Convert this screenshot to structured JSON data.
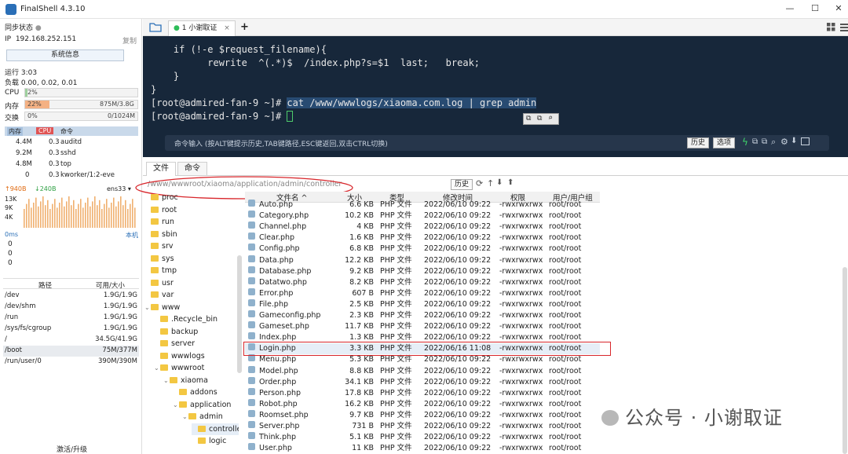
{
  "window": {
    "title": "FinalShell 4.3.10",
    "controls": [
      "—",
      "☐",
      "✕"
    ]
  },
  "left": {
    "sync_label": "同步状态",
    "ip_label": "IP",
    "ip": "192.168.252.151",
    "copy": "复制",
    "sysinfo_button": "系统信息",
    "uptime": "运行 3:03",
    "load": "负载 0.00, 0.02, 0.01",
    "cpu": {
      "label": "CPU",
      "value": "2%",
      "pct": 2
    },
    "mem": {
      "label": "内存",
      "value": "22%",
      "pct": 22,
      "detail": "875M/3.8G"
    },
    "swap": {
      "label": "交换",
      "value": "0%",
      "pct": 0,
      "detail": "0/1024M"
    },
    "proc_headers": [
      "内存",
      "CPU",
      "命令"
    ],
    "procs": [
      {
        "mem": "4.4M",
        "cpu": "0.3",
        "cmd": "auditd"
      },
      {
        "mem": "9.2M",
        "cpu": "0.3",
        "cmd": "sshd"
      },
      {
        "mem": "4.8M",
        "cpu": "0.3",
        "cmd": "top"
      },
      {
        "mem": "0",
        "cpu": "0.3",
        "cmd": "kworker/1:2-eve"
      }
    ],
    "net": {
      "up": "↑940B",
      "down": "↓240B",
      "iface": "ens33 ▾",
      "scale": [
        "13K",
        "9K",
        "4K"
      ]
    },
    "latency": {
      "ms": "0ms",
      "host": "本机",
      "values": [
        "0",
        "0",
        "0"
      ]
    },
    "disk_headers": [
      "路径",
      "可用/大小"
    ],
    "disks": [
      {
        "path": "/dev",
        "size": "1.9G/1.9G"
      },
      {
        "path": "/dev/shm",
        "size": "1.9G/1.9G"
      },
      {
        "path": "/run",
        "size": "1.9G/1.9G"
      },
      {
        "path": "/sys/fs/cgroup",
        "size": "1.9G/1.9G"
      },
      {
        "path": "/",
        "size": "34.5G/41.9G"
      },
      {
        "path": "/boot",
        "size": "75M/377M"
      },
      {
        "path": "/run/user/0",
        "size": "390M/390M"
      }
    ],
    "activate": "激活/升级"
  },
  "session_tab": {
    "dot": "●",
    "label": "1 小谢取证",
    "close": "×",
    "add": "+"
  },
  "terminal": {
    "lines": [
      "    if (!-e $request_filename){",
      "          rewrite  ^(.*)$  /index.php?s=$1  last;   break;",
      "    }",
      "}",
      "[root@admired-fan-9 ~]# ",
      "[root@admired-fan-9 ~]# "
    ],
    "command": "cat /www/wwwlogs/xiaoma.com.log | grep admin",
    "cmd_hint": "命令输入 (按ALT键提示历史,TAB键路径,ESC键返回,双击CTRL切换)",
    "history_btn": "历史",
    "options_btn": "选项"
  },
  "file_tabs": [
    "文件",
    "命令"
  ],
  "path": "/www/wwwroot/xiaoma/application/admin/controller",
  "path_history_btn": "历史",
  "tree": [
    {
      "name": "proc",
      "depth": 0
    },
    {
      "name": "root",
      "depth": 0
    },
    {
      "name": "run",
      "depth": 0
    },
    {
      "name": "sbin",
      "depth": 0
    },
    {
      "name": "srv",
      "depth": 0
    },
    {
      "name": "sys",
      "depth": 0
    },
    {
      "name": "tmp",
      "depth": 0
    },
    {
      "name": "usr",
      "depth": 0
    },
    {
      "name": "var",
      "depth": 0
    },
    {
      "name": "www",
      "depth": 0,
      "open": true
    },
    {
      "name": ".Recycle_bin",
      "depth": 1
    },
    {
      "name": "backup",
      "depth": 1
    },
    {
      "name": "server",
      "depth": 1
    },
    {
      "name": "wwwlogs",
      "depth": 1
    },
    {
      "name": "wwwroot",
      "depth": 1,
      "open": true
    },
    {
      "name": "xiaoma",
      "depth": 2,
      "open": true
    },
    {
      "name": "addons",
      "depth": 3
    },
    {
      "name": "application",
      "depth": 3,
      "open": true
    },
    {
      "name": "admin",
      "depth": 4,
      "open": true
    },
    {
      "name": "controller",
      "depth": 5,
      "selected": true
    },
    {
      "name": "logic",
      "depth": 5
    }
  ],
  "file_headers": [
    "文件名 ^",
    "大小",
    "类型",
    "修改时间",
    "权限",
    "用户/用户组"
  ],
  "files": [
    {
      "name": "Auto.php",
      "size": "6.6 KB",
      "type": "PHP 文件",
      "mtime": "2022/06/10 09:22",
      "perm": "-rwxrwxrwx",
      "owner": "root/root"
    },
    {
      "name": "Category.php",
      "size": "10.2 KB",
      "type": "PHP 文件",
      "mtime": "2022/06/10 09:22",
      "perm": "-rwxrwxrwx",
      "owner": "root/root"
    },
    {
      "name": "Channel.php",
      "size": "4 KB",
      "type": "PHP 文件",
      "mtime": "2022/06/10 09:22",
      "perm": "-rwxrwxrwx",
      "owner": "root/root"
    },
    {
      "name": "Clear.php",
      "size": "1.6 KB",
      "type": "PHP 文件",
      "mtime": "2022/06/10 09:22",
      "perm": "-rwxrwxrwx",
      "owner": "root/root"
    },
    {
      "name": "Config.php",
      "size": "6.8 KB",
      "type": "PHP 文件",
      "mtime": "2022/06/10 09:22",
      "perm": "-rwxrwxrwx",
      "owner": "root/root"
    },
    {
      "name": "Data.php",
      "size": "12.2 KB",
      "type": "PHP 文件",
      "mtime": "2022/06/10 09:22",
      "perm": "-rwxrwxrwx",
      "owner": "root/root"
    },
    {
      "name": "Database.php",
      "size": "9.2 KB",
      "type": "PHP 文件",
      "mtime": "2022/06/10 09:22",
      "perm": "-rwxrwxrwx",
      "owner": "root/root"
    },
    {
      "name": "Datatwo.php",
      "size": "8.2 KB",
      "type": "PHP 文件",
      "mtime": "2022/06/10 09:22",
      "perm": "-rwxrwxrwx",
      "owner": "root/root"
    },
    {
      "name": "Error.php",
      "size": "607 B",
      "type": "PHP 文件",
      "mtime": "2022/06/10 09:22",
      "perm": "-rwxrwxrwx",
      "owner": "root/root"
    },
    {
      "name": "File.php",
      "size": "2.5 KB",
      "type": "PHP 文件",
      "mtime": "2022/06/10 09:22",
      "perm": "-rwxrwxrwx",
      "owner": "root/root"
    },
    {
      "name": "Gameconfig.php",
      "size": "2.3 KB",
      "type": "PHP 文件",
      "mtime": "2022/06/10 09:22",
      "perm": "-rwxrwxrwx",
      "owner": "root/root"
    },
    {
      "name": "Gameset.php",
      "size": "11.7 KB",
      "type": "PHP 文件",
      "mtime": "2022/06/10 09:22",
      "perm": "-rwxrwxrwx",
      "owner": "root/root"
    },
    {
      "name": "Index.php",
      "size": "1.3 KB",
      "type": "PHP 文件",
      "mtime": "2022/06/10 09:22",
      "perm": "-rwxrwxrwx",
      "owner": "root/root"
    },
    {
      "name": "Login.php",
      "size": "3.3 KB",
      "type": "PHP 文件",
      "mtime": "2022/06/16 11:08",
      "perm": "-rwxrwxrwx",
      "owner": "root/root",
      "highlight": true
    },
    {
      "name": "Menu.php",
      "size": "5.3 KB",
      "type": "PHP 文件",
      "mtime": "2022/06/10 09:22",
      "perm": "-rwxrwxrwx",
      "owner": "root/root"
    },
    {
      "name": "Model.php",
      "size": "8.8 KB",
      "type": "PHP 文件",
      "mtime": "2022/06/10 09:22",
      "perm": "-rwxrwxrwx",
      "owner": "root/root"
    },
    {
      "name": "Order.php",
      "size": "34.1 KB",
      "type": "PHP 文件",
      "mtime": "2022/06/10 09:22",
      "perm": "-rwxrwxrwx",
      "owner": "root/root"
    },
    {
      "name": "Person.php",
      "size": "17.8 KB",
      "type": "PHP 文件",
      "mtime": "2022/06/10 09:22",
      "perm": "-rwxrwxrwx",
      "owner": "root/root"
    },
    {
      "name": "Robot.php",
      "size": "16.2 KB",
      "type": "PHP 文件",
      "mtime": "2022/06/10 09:22",
      "perm": "-rwxrwxrwx",
      "owner": "root/root"
    },
    {
      "name": "Roomset.php",
      "size": "9.7 KB",
      "type": "PHP 文件",
      "mtime": "2022/06/10 09:22",
      "perm": "-rwxrwxrwx",
      "owner": "root/root"
    },
    {
      "name": "Server.php",
      "size": "731 B",
      "type": "PHP 文件",
      "mtime": "2022/06/10 09:22",
      "perm": "-rwxrwxrwx",
      "owner": "root/root"
    },
    {
      "name": "Think.php",
      "size": "5.1 KB",
      "type": "PHP 文件",
      "mtime": "2022/06/10 09:22",
      "perm": "-rwxrwxrwx",
      "owner": "root/root"
    },
    {
      "name": "User.php",
      "size": "11 KB",
      "type": "PHP 文件",
      "mtime": "2022/06/10 09:22",
      "perm": "-rwxrwxrwx",
      "owner": "root/root"
    }
  ],
  "watermark": "公众号 · 小谢取证",
  "colors": {
    "terminal_bg": "#17273a",
    "accent": "#2a6fb7",
    "annotation_red": "#d8262b",
    "net_up": "#e06a10",
    "net_down": "#2ea043"
  }
}
